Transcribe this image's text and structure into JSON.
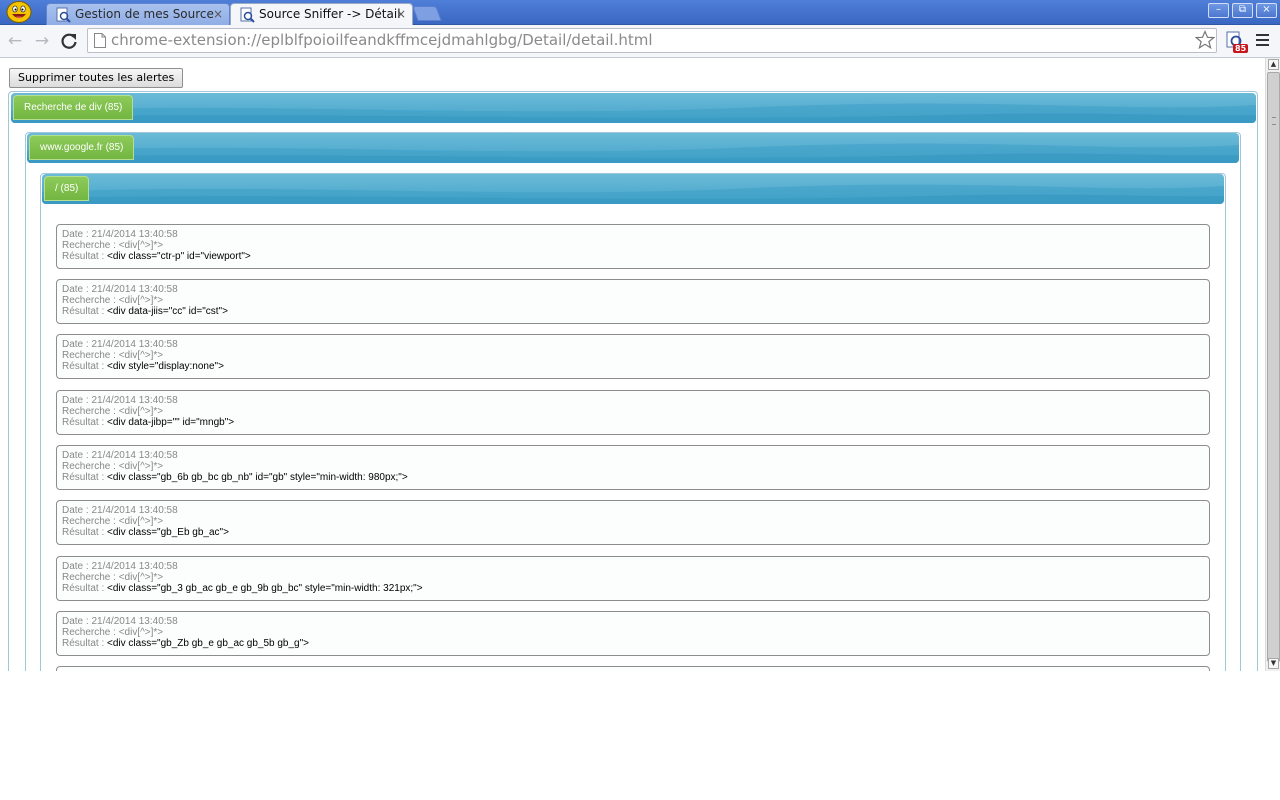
{
  "browser": {
    "tabs": [
      {
        "title": "Gestion de mes Source",
        "active": false
      },
      {
        "title": "Source Sniffer -> Détail",
        "active": true
      }
    ],
    "close_glyph": "×",
    "url": "chrome-extension://eplblfpoioilfeandkffmcejdmahlgbg/Detail/detail.html",
    "extension_badge": "85",
    "nav": {
      "back": "←",
      "forward": "→",
      "reload": "C"
    },
    "window_controls": {
      "minimize": "–",
      "restore": "⧉",
      "close": "×"
    }
  },
  "page": {
    "clear_button_label": "Supprimer toutes les alertes",
    "groups": {
      "search_type": "Recherche de div (85)",
      "domain": "www.google.fr (85)",
      "path": "/ (85)"
    },
    "labels": {
      "date": "Date : ",
      "search": "Recherche : ",
      "result": "Résultat : "
    },
    "alerts": [
      {
        "date": "21/4/2014 13:40:58",
        "search": "<div[^>]*>",
        "result": "<div class=\"ctr-p\" id=\"viewport\">"
      },
      {
        "date": "21/4/2014 13:40:58",
        "search": "<div[^>]*>",
        "result": "<div data-jiis=\"cc\" id=\"cst\">"
      },
      {
        "date": "21/4/2014 13:40:58",
        "search": "<div[^>]*>",
        "result": "<div style=\"display:none\">"
      },
      {
        "date": "21/4/2014 13:40:58",
        "search": "<div[^>]*>",
        "result": "<div data-jibp=\"\" id=\"mngb\">"
      },
      {
        "date": "21/4/2014 13:40:58",
        "search": "<div[^>]*>",
        "result": "<div class=\"gb_6b gb_bc gb_nb\" id=\"gb\" style=\"min-width: 980px;\">"
      },
      {
        "date": "21/4/2014 13:40:58",
        "search": "<div[^>]*>",
        "result": "<div class=\"gb_Eb gb_ac\">"
      },
      {
        "date": "21/4/2014 13:40:58",
        "search": "<div[^>]*>",
        "result": "<div class=\"gb_3 gb_ac gb_e gb_9b gb_bc\" style=\"min-width: 321px;\">"
      },
      {
        "date": "21/4/2014 13:40:58",
        "search": "<div[^>]*>",
        "result": "<div class=\"gb_Zb gb_e gb_ac gb_5b gb_g\">"
      },
      {
        "date": "",
        "search": "",
        "result": ""
      }
    ]
  },
  "colors": {
    "header_blue": "#4aa6cc",
    "tab_green": "#7cbd4a",
    "titlebar_blue": "#3a67c2"
  }
}
